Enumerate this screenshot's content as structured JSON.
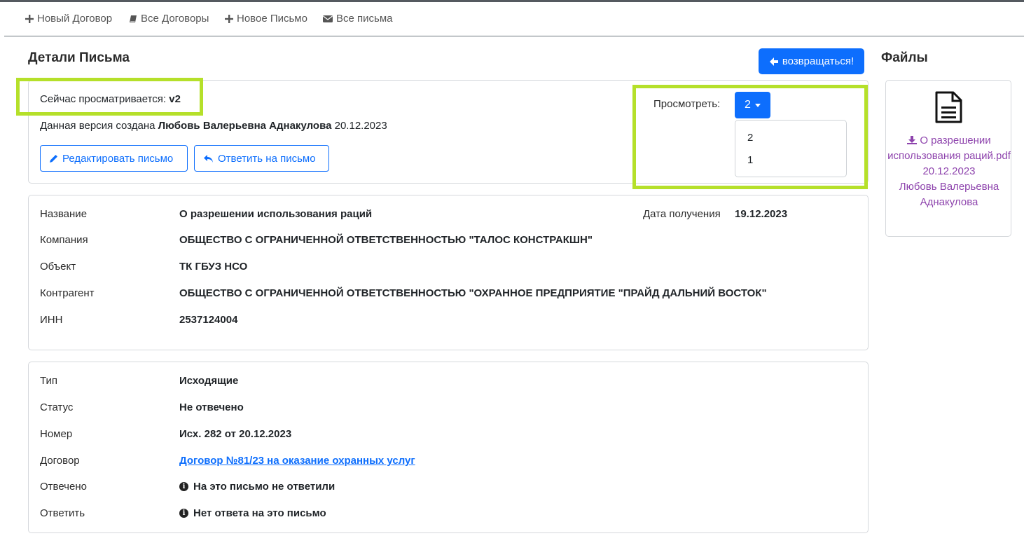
{
  "nav": {
    "items": [
      {
        "label": "Новый Договор",
        "icon": "plus-icon"
      },
      {
        "label": "Все Договоры",
        "icon": "book-icon"
      },
      {
        "label": "Новое Письмо",
        "icon": "plus-icon"
      },
      {
        "label": "Все письма",
        "icon": "envelope-icon"
      }
    ]
  },
  "page": {
    "title": "Детали Письма",
    "back_label": "возвращаться!",
    "files_title": "Файлы"
  },
  "version": {
    "viewing_prefix": "Сейчас просматривается:",
    "viewing_value": "v2",
    "created_prefix": "Данная версия создана",
    "created_by": "Любовь Валерьевна Аднакулова",
    "created_date": "20.12.2023",
    "edit_label": "Редактировать письмо",
    "reply_label": "Ответить на письмо",
    "view_label": "Просмотреть:",
    "selected": "2",
    "options": [
      "2",
      "1"
    ]
  },
  "details": {
    "name_label": "Название",
    "name_value": "О разрешении использования раций",
    "date_label": "Дата получения",
    "date_value": "19.12.2023",
    "company_label": "Компания",
    "company_value": "ОБЩЕСТВО С ОГРАНИЧЕННОЙ ОТВЕТСТВЕННОСТЬЮ \"ТАЛОС КОНСТРАКШН\"",
    "object_label": "Объект",
    "object_value": "ТК ГБУЗ НСО",
    "counterparty_label": "Контрагент",
    "counterparty_value": "ОБЩЕСТВО С ОГРАНИЧЕННОЙ ОТВЕТСТВЕННОСТЬЮ \"ОХРАННОЕ ПРЕДПРИЯТИЕ \"ПРАЙД ДАЛЬНИЙ ВОСТОК\"",
    "inn_label": "ИНН",
    "inn_value": "2537124004"
  },
  "meta": {
    "type_label": "Тип",
    "type_value": "Исходящие",
    "status_label": "Статус",
    "status_value": "Не отвечено",
    "number_label": "Номер",
    "number_value": "Исх. 282 от 20.12.2023",
    "contract_label": "Договор",
    "contract_value": "Договор №81/23 на оказание охранных услуг",
    "answered_label": "Отвечено",
    "answered_value": "На это письмо не ответили",
    "reply_label": "Ответить",
    "reply_value": "Нет ответа на это письмо"
  },
  "file": {
    "icon": "file-text-icon",
    "name": "О разрешении использования раций.pdf",
    "date": "20.12.2023",
    "author": "Любовь Валерьевна Аднакулова"
  },
  "colors": {
    "primary": "#0d6efd",
    "highlight": "#b5e02a",
    "file_link": "#8e44ad"
  }
}
